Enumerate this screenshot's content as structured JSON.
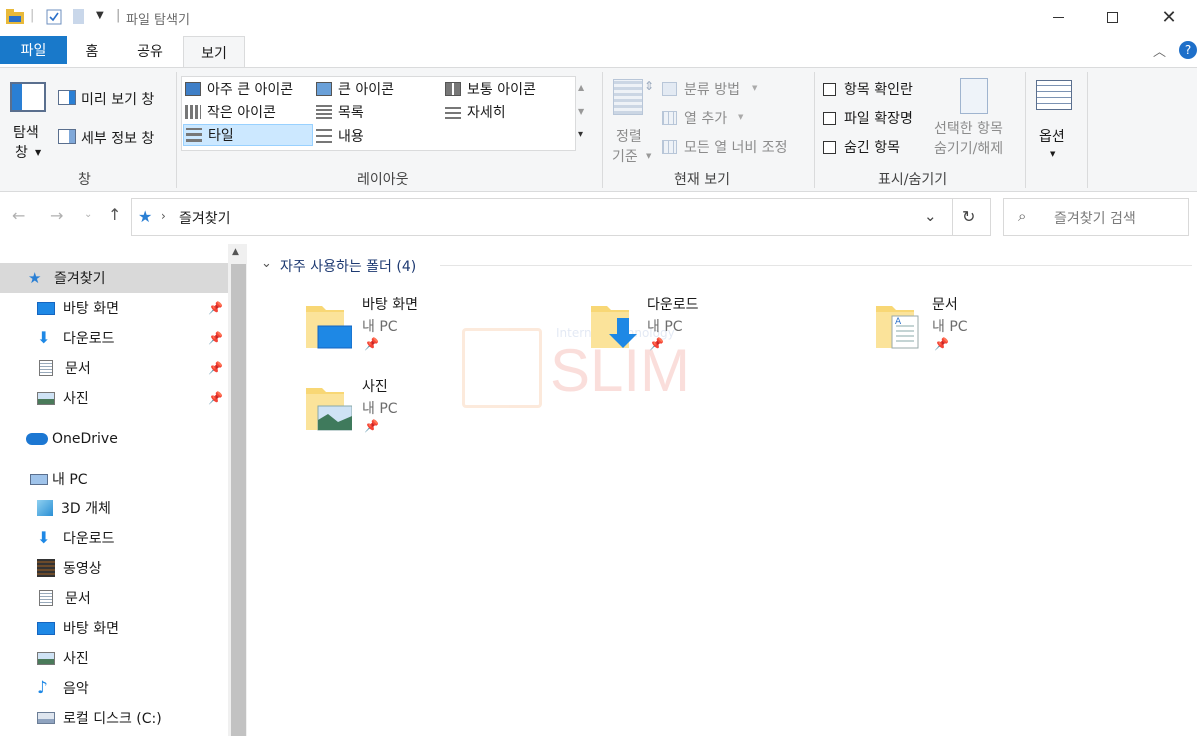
{
  "window": {
    "title": "파일 탐색기",
    "title_sep": "|"
  },
  "tabs": [
    {
      "label": "파일"
    },
    {
      "label": "홈"
    },
    {
      "label": "공유"
    },
    {
      "label": "보기"
    }
  ],
  "ribbon": {
    "panes": {
      "nav_pane_line1": "탐색",
      "nav_pane_line2": "창",
      "preview": "미리 보기 창",
      "details": "세부 정보 창",
      "group_label": "창"
    },
    "layout": {
      "items": [
        {
          "label": "아주 큰 아이콘"
        },
        {
          "label": "큰 아이콘"
        },
        {
          "label": "보통 아이콘"
        },
        {
          "label": "작은 아이콘"
        },
        {
          "label": "목록"
        },
        {
          "label": "자세히"
        },
        {
          "label": "타일"
        },
        {
          "label": "내용"
        }
      ],
      "group_label": "레이아웃"
    },
    "current_view": {
      "sort_line1": "정렬",
      "sort_line2": "기준",
      "group_by": "분류 방법",
      "add_columns": "열 추가",
      "size_columns": "모든 열 너비 조정",
      "group_label": "현재 보기"
    },
    "show_hide": {
      "item_checkbox": "항목 확인란",
      "extensions": "파일 확장명",
      "hidden_items": "숨긴 항목",
      "hide_selected_line1": "선택한 항목",
      "hide_selected_line2": "숨기기/해제",
      "group_label": "표시/숨기기"
    },
    "options": {
      "label": "옵션"
    }
  },
  "address": {
    "path": "즐겨찾기",
    "search_placeholder": "즐겨찾기 검색"
  },
  "nav": {
    "quick_access": "즐겨찾기",
    "pinned": [
      {
        "label": "바탕 화면"
      },
      {
        "label": "다운로드"
      },
      {
        "label": "문서"
      },
      {
        "label": "사진"
      }
    ],
    "onedrive": "OneDrive",
    "this_pc": "내 PC",
    "pc_items": [
      {
        "label": "3D 개체"
      },
      {
        "label": "다운로드"
      },
      {
        "label": "동영상"
      },
      {
        "label": "문서"
      },
      {
        "label": "바탕 화면"
      },
      {
        "label": "사진"
      },
      {
        "label": "음악"
      },
      {
        "label": "로컬 디스크 (C:)"
      }
    ]
  },
  "content": {
    "section_title": "자주 사용하는 폴더 (4)",
    "folders": [
      {
        "name": "바탕 화면",
        "location": "내 PC"
      },
      {
        "name": "다운로드",
        "location": "내 PC"
      },
      {
        "name": "문서",
        "location": "내 PC"
      },
      {
        "name": "사진",
        "location": "내 PC"
      }
    ]
  },
  "watermark": {
    "text": "SLIM",
    "small": "Internet Technology"
  },
  "colors": {
    "file_tab": "#1979ca",
    "folder_yellow": "#f8d775",
    "accent_blue": "#1e88e5",
    "selected_nav": "#d9d9d9",
    "selected_layout": "#cce8ff"
  }
}
